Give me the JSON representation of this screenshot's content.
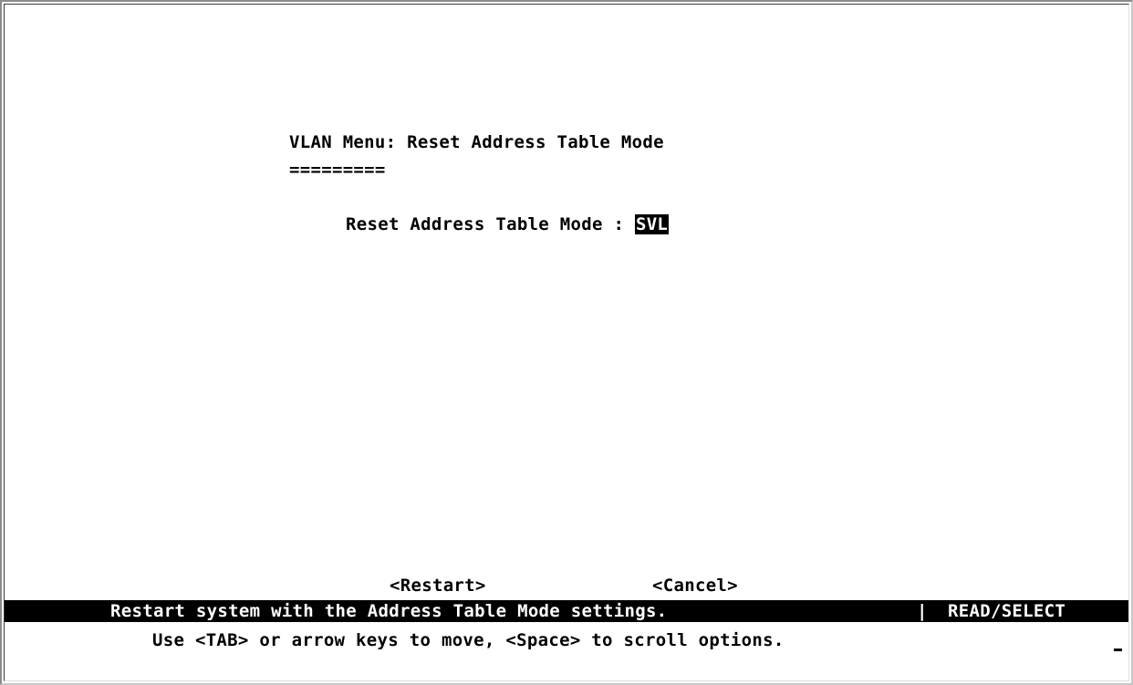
{
  "screen": {
    "title": "VLAN Menu: Reset Address Table Mode",
    "title_underline": "========="
  },
  "form": {
    "field_label": "Reset Address Table Mode : ",
    "field_value": "SVL"
  },
  "buttons": {
    "restart_label": "<Restart>",
    "cancel_label": "<Cancel>"
  },
  "status_bar": {
    "message": "Restart system with the Address Table Mode settings.",
    "separator": "|",
    "mode": "READ/SELECT"
  },
  "hint": "Use <TAB> or arrow keys to move, <Space> to scroll options.",
  "colors": {
    "background": "#ffffff",
    "foreground": "#000000",
    "highlight_bg": "#000000",
    "highlight_fg": "#ffffff"
  }
}
